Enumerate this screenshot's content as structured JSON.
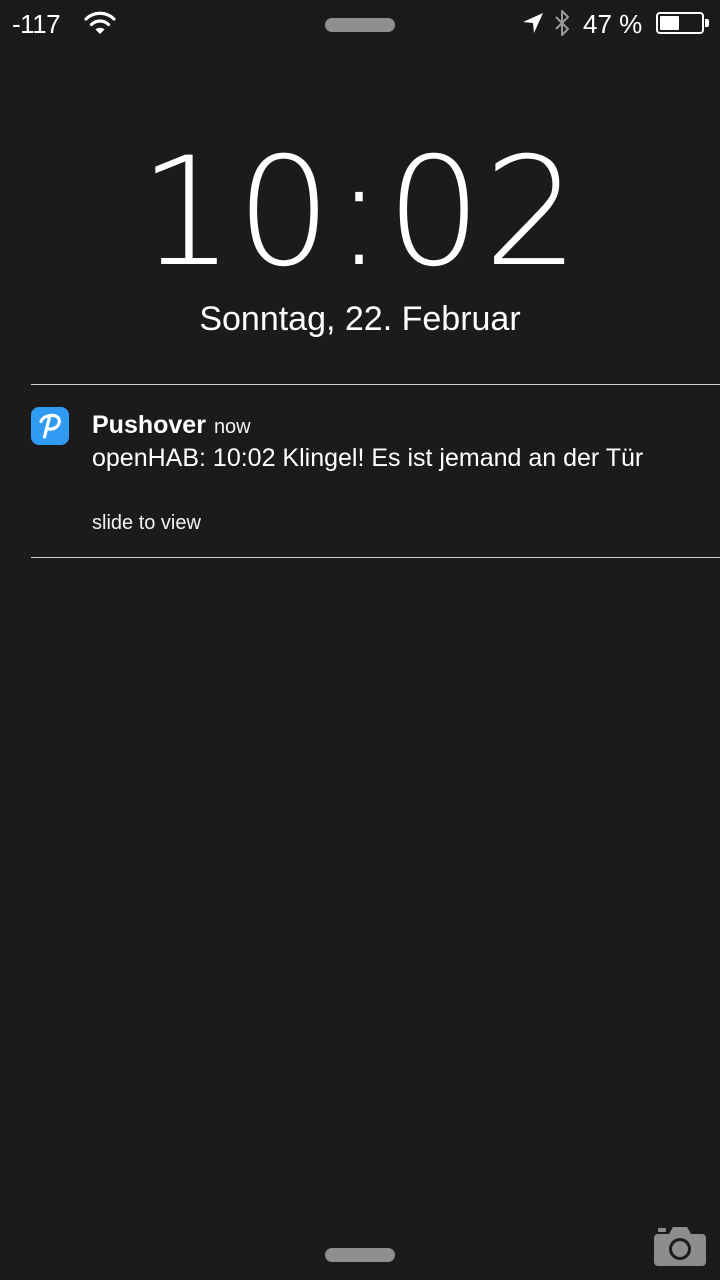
{
  "status_bar": {
    "signal": "-117",
    "battery_percent": "47 %",
    "battery_level": 0.47
  },
  "lock_screen": {
    "time": "10:02",
    "date": "Sonntag, 22. Februar"
  },
  "notification": {
    "app_name": "Pushover",
    "time": "now",
    "message": "openHAB: 10:02 Klingel! Es ist jemand an der Tür",
    "action_hint": "slide to view",
    "icon_color": "#2f9bf3",
    "icon": "pushover-p-icon"
  },
  "colors": {
    "background": "#1c1b1c",
    "grabber": "#8f8f92",
    "divider": "#d0d0d0"
  },
  "icons": [
    "wifi-icon",
    "location-arrow-icon",
    "bluetooth-icon",
    "battery-icon",
    "camera-icon"
  ]
}
